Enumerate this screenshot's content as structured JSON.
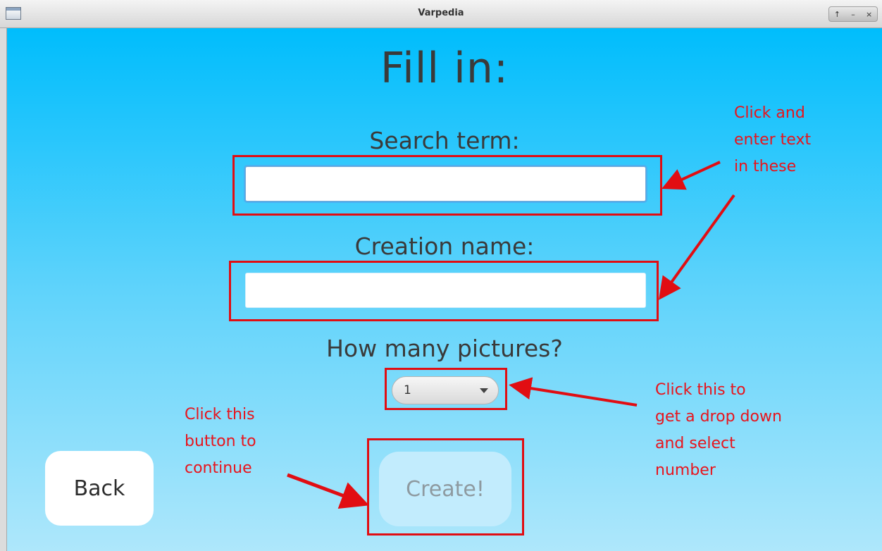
{
  "window": {
    "title": "Varpedia",
    "controls": [
      "↑",
      "–",
      "×"
    ]
  },
  "form": {
    "heading": "Fill in:",
    "search_label": "Search term:",
    "search_value": "",
    "creation_label": "Creation name:",
    "creation_value": "",
    "pictures_label": "How many pictures?",
    "pictures_selected": "1"
  },
  "buttons": {
    "back": "Back",
    "create": "Create!"
  },
  "annotations": {
    "text_inputs": "Click and\nenter text\nin these",
    "dropdown": "Click this to\nget a drop down\nand select\nnumber",
    "create_button": "Click this\nbutton to\ncontinue"
  },
  "colors": {
    "background_top": "#00bdfc",
    "background_bottom": "#aee7fb",
    "annotation_red": "#e10d12",
    "heading_text": "#3a3a3a"
  }
}
